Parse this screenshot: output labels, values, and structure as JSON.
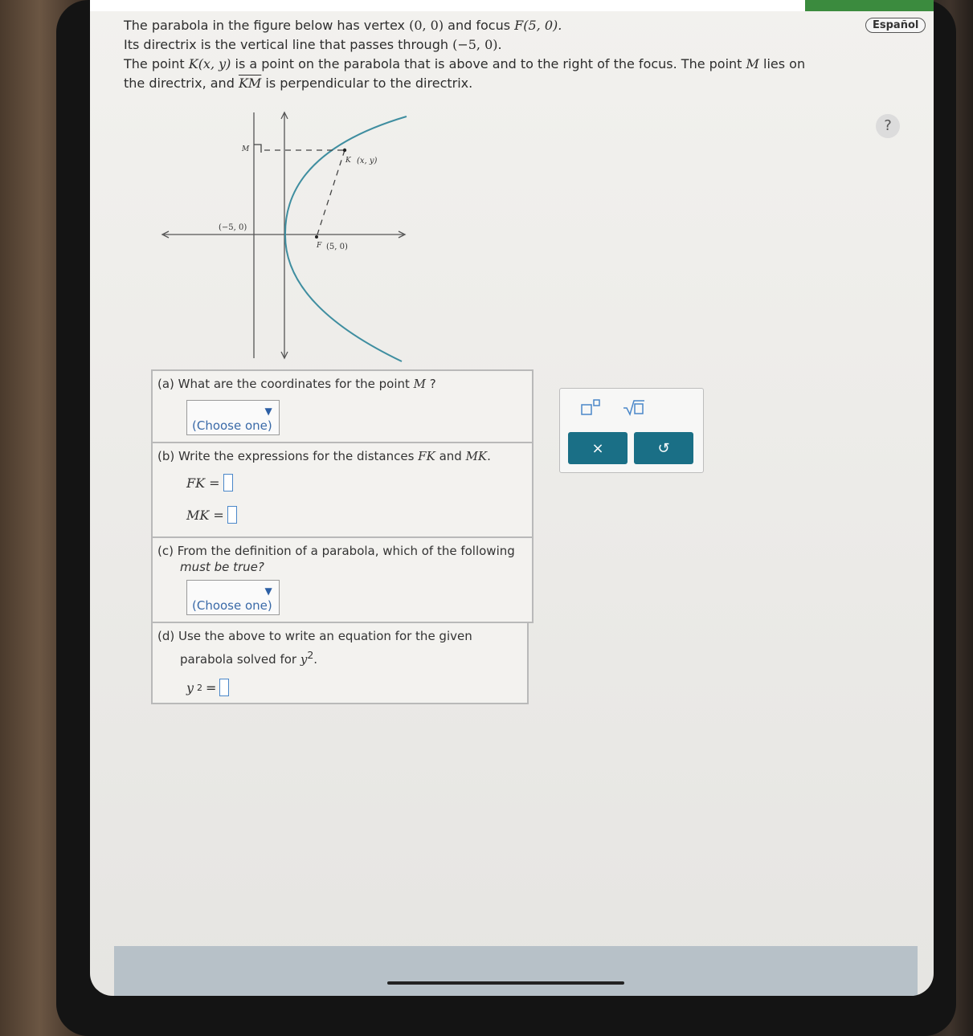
{
  "header": {
    "language_button": "Español",
    "help_icon": "?"
  },
  "problem": {
    "s1": "The parabola in the figure below has vertex ",
    "vertex": "(0, 0)",
    "s2": " and focus ",
    "focus": "F(5, 0).",
    "s3": "Its directrix is the vertical line that passes through ",
    "directrix_point": "(−5, 0).",
    "s4": "The point ",
    "point_k": "K(x, y)",
    "s5": " is a point on the parabola that is above and to the right of the focus. The point ",
    "point_m": "M",
    "s6": " lies on",
    "s7": "the directrix, and ",
    "segment": "KM",
    "s8": " is perpendicular to the directrix."
  },
  "graph": {
    "label_m": "M",
    "label_k": "K",
    "label_k_coords": "(x, y)",
    "label_dir": "(−5, 0)",
    "label_f": "F",
    "label_f_coords": "(5, 0)"
  },
  "parts": {
    "a": {
      "question": "(a) What are the coordinates for the point ",
      "var": "M",
      "qmark": " ?",
      "dropdown": "(Choose one)"
    },
    "b": {
      "question": "(b) Write the expressions for the distances ",
      "fk": "FK",
      "and": " and ",
      "mk": "MK",
      "period": ".",
      "fk_eq": "FK =",
      "mk_eq": "MK ="
    },
    "c": {
      "question1": "(c) From the definition of a parabola, which of the following",
      "question2": "must be true?",
      "dropdown": "(Choose one)"
    },
    "d": {
      "question1": "(d) Use the above to write an equation for the given",
      "question2": "parabola solved for ",
      "var": "y",
      "exp": "2",
      "period": ".",
      "eq_var": "y",
      "eq_exp": "2",
      "eq_sign": "="
    }
  },
  "toolbox": {
    "clear": "×",
    "undo": "↺"
  },
  "colors": {
    "curve": "#3f8ea0",
    "accent": "#1a6f86",
    "link": "#3a6aa8"
  }
}
